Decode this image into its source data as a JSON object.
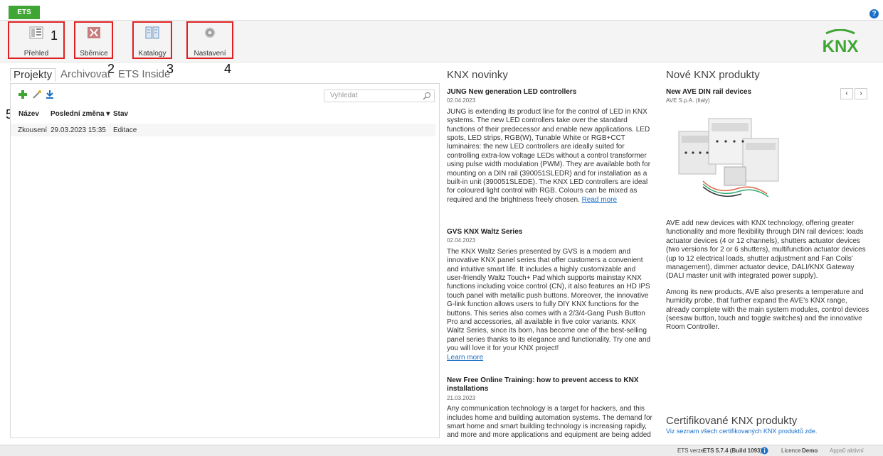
{
  "app": {
    "tab": "ETS",
    "help": "?"
  },
  "ribbon": {
    "items": [
      {
        "label": "Přehled",
        "num": "1"
      },
      {
        "label": "Sběrnice",
        "num": "2"
      },
      {
        "label": "Katalogy",
        "num": "3"
      },
      {
        "label": "Nastavení",
        "num": "4"
      }
    ],
    "logo": "KNX"
  },
  "left": {
    "tabs": [
      "Projekty",
      "Archivovat",
      "ETS Inside"
    ],
    "toolbar_num": "5",
    "search_placeholder": "Vyhledat",
    "columns": [
      "Název",
      "Poslední změna ▾",
      "Stav"
    ],
    "rows": [
      {
        "name": "Zkousení",
        "changed": "29.03.2023 15:35",
        "state": "Editace"
      }
    ]
  },
  "news": {
    "title": "KNX novinky",
    "items": [
      {
        "title": "JUNG New generation LED controllers",
        "date": "02.04.2023",
        "body": "JUNG is extending its product line for the control of LED in KNX systems. The new LED controllers take over the standard functions of their predecessor and enable new applications. LED spots, LED strips, RGB(W), Tunable White or RGB+CCT luminaires: the new LED controllers are ideally suited for controlling extra-low voltage LEDs without a control transformer using pulse width modulation (PWM). They are available both for mounting on a DIN rail (390051SLEDR) and for installation as a built-in unit (390051SLEDE). The KNX LED controllers are ideal for coloured light control with RGB. Colours can be mixed as required and the brightness freely chosen.",
        "link": "Read more"
      },
      {
        "title": "GVS KNX Waltz Series",
        "date": "02.04.2023",
        "body": "The KNX Waltz Series presented by GVS is a modern and innovative KNX panel series that offer customers a convenient and intuitive smart life. It includes a highly customizable and user-friendly Waltz Touch+ Pad which supports mainstay KNX functions including voice control (CN), it also features an HD IPS touch panel with metallic push buttons. Moreover, the innovative G-link function allows users to fully DIY KNX functions for the buttons. This series also comes with a 2/3/4-Gang Push Button Pro and accessories, all available in five color variants. KNX Waltz Series, since its born, has become one of the best-selling panel series thanks to its elegance and functionality. Try one and you will love it for your KNX project!",
        "link": "Learn more"
      },
      {
        "title": "New Free Online Training: how to prevent access to KNX installations",
        "date": "21.03.2023",
        "body": "Any communication technology is a target for hackers, and this includes home and building automation systems. The demand for smart home and smart building technology is increasing rapidly, and more and more applications and equipment are being added",
        "link": ""
      }
    ]
  },
  "products": {
    "title": "Nové KNX produkty",
    "item_title": "New AVE DIN rail devices",
    "item_company": "AVE S.p.A. (Italy)",
    "prev": "‹",
    "next": "›",
    "p1": "AVE add new devices with KNX technology, offering greater functionality and more flexibility through DIN rail devices: loads actuator devices (4 or 12 channels), shutters actuator devices (two versions for 2 or 6 shutters), multifunction actuator devices (up to 12 electrical loads, shutter adjustment and Fan Coils' management), dimmer actuator device, DALI/KNX Gateway (DALI master unit with integrated power supply).",
    "p2": "Among its new products, AVE also presents a temperature and humidity probe, that further expand the AVE's KNX range, already complete with the main system modules, control devices (seesaw button, touch and toggle switches) and the innovative Room Controller.",
    "cert_title": "Certifikované KNX produkty",
    "cert_link": "Viz seznam všech certifikovaných KNX produktů zde."
  },
  "status": {
    "version_label": "ETS verze",
    "version": "ETS 5.7.4 (Build 1093)",
    "licence_label": "Licence",
    "licence": "Demo",
    "apps_label": "Apps",
    "apps": "0 aktivní"
  },
  "colors": {
    "accent_green": "#3fa535",
    "highlight_red": "#e02020",
    "link_blue": "#1a6fc9"
  }
}
